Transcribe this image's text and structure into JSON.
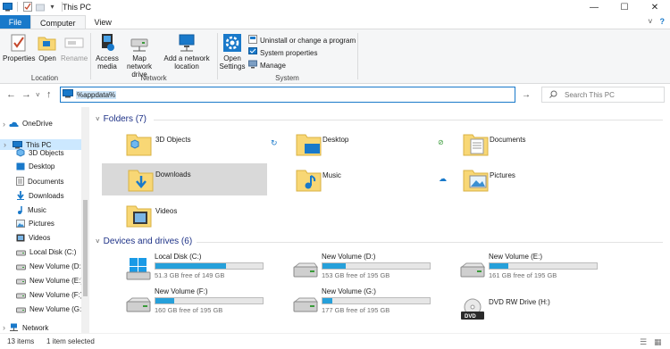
{
  "window": {
    "title": "This PC",
    "controls": {
      "minimize": "—",
      "maximize": "☐",
      "close": "✕"
    }
  },
  "tabs": {
    "file": "File",
    "computer": "Computer",
    "view": "View"
  },
  "ribbon": {
    "location": {
      "label": "Location",
      "properties": "Properties",
      "open": "Open",
      "rename": "Rename"
    },
    "network": {
      "label": "Network",
      "access_media": "Access media",
      "map_network_drive": "Map network drive",
      "add_network_location": "Add a network location"
    },
    "system": {
      "label": "System",
      "open_settings": "Open Settings",
      "uninstall": "Uninstall or change a program",
      "system_properties": "System properties",
      "manage": "Manage"
    }
  },
  "address": {
    "value": "%appdata%",
    "search_placeholder": "Search This PC"
  },
  "nav": {
    "items": [
      {
        "label": "OneDrive",
        "icon": "cloud-icon"
      },
      {
        "label": "This PC",
        "icon": "computer-icon"
      },
      {
        "label": "3D Objects",
        "icon": "cube-icon"
      },
      {
        "label": "Desktop",
        "icon": "desktop-icon"
      },
      {
        "label": "Documents",
        "icon": "document-icon"
      },
      {
        "label": "Downloads",
        "icon": "download-icon"
      },
      {
        "label": "Music",
        "icon": "music-icon"
      },
      {
        "label": "Pictures",
        "icon": "picture-icon"
      },
      {
        "label": "Videos",
        "icon": "video-icon"
      },
      {
        "label": "Local Disk (C:)",
        "icon": "drive-icon"
      },
      {
        "label": "New Volume (D:",
        "icon": "drive-icon"
      },
      {
        "label": "New Volume (E:)",
        "icon": "drive-icon"
      },
      {
        "label": "New Volume (F:)",
        "icon": "drive-icon"
      },
      {
        "label": "New Volume (G:)",
        "icon": "drive-icon"
      },
      {
        "label": "Network",
        "icon": "network-icon"
      }
    ]
  },
  "folders": {
    "header": "Folders (7)",
    "items": [
      {
        "name": "3D Objects"
      },
      {
        "name": "Desktop"
      },
      {
        "name": "Documents"
      },
      {
        "name": "Downloads"
      },
      {
        "name": "Music"
      },
      {
        "name": "Pictures"
      },
      {
        "name": "Videos"
      }
    ]
  },
  "drives": {
    "header": "Devices and drives (6)",
    "items": [
      {
        "name": "Local Disk (C:)",
        "free": "51.3 GB free of 149 GB",
        "used_fraction": 0.656
      },
      {
        "name": "New Volume (D:)",
        "free": "153 GB free of 195 GB",
        "used_fraction": 0.215
      },
      {
        "name": "New Volume (E:)",
        "free": "161 GB free of 195 GB",
        "used_fraction": 0.174
      },
      {
        "name": "New Volume (F:)",
        "free": "160 GB free of 195 GB",
        "used_fraction": 0.179
      },
      {
        "name": "New Volume (G:)",
        "free": "177 GB free of 195 GB",
        "used_fraction": 0.092
      },
      {
        "name": "DVD RW Drive (H:)",
        "free": "",
        "used_fraction": null
      }
    ]
  },
  "status": {
    "count": "13 items",
    "selected": "1 item selected"
  },
  "colors": {
    "accent": "#1979ca",
    "bar_fill": "#26a0da",
    "folder": "#f8d775",
    "header_blue": "#1e3287"
  }
}
